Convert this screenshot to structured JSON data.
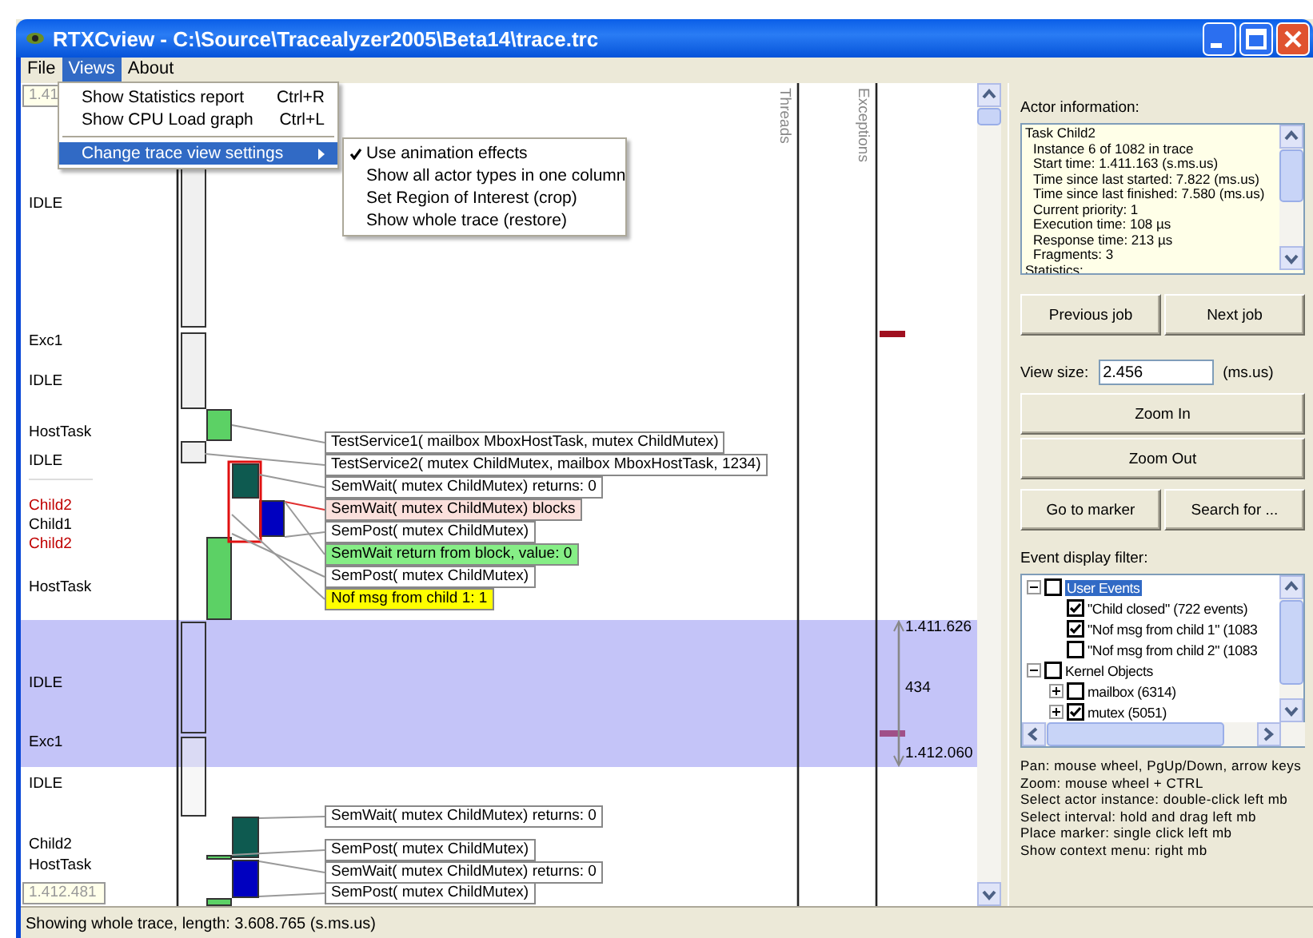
{
  "window": {
    "title": "RTXCview - C:\\Source\\Tracealyzer2005\\Beta14\\trace.trc"
  },
  "menu_bar": [
    {
      "label": "File",
      "selected": false
    },
    {
      "label": "Views",
      "selected": true
    },
    {
      "label": "About",
      "selected": false
    }
  ],
  "views_menu": {
    "items": [
      {
        "kind": "item",
        "label": "Show Statistics report",
        "shortcut": "Ctrl+R",
        "selected": false
      },
      {
        "kind": "item",
        "label": "Show CPU Load graph",
        "shortcut": "Ctrl+L",
        "selected": false
      },
      {
        "kind": "separator"
      },
      {
        "kind": "submenu",
        "label": "Change trace view settings",
        "selected": true
      }
    ],
    "submenu": [
      {
        "label": "Use animation effects",
        "checked": true
      },
      {
        "label": "Show all actor types in one column",
        "checked": false
      },
      {
        "label": "Set Region of Interest (crop)",
        "checked": false
      },
      {
        "label": "Show whole trace (restore)",
        "checked": false
      }
    ]
  },
  "trace": {
    "top_time": "1.41",
    "bottom_time": "1.412.481",
    "column_headers": [
      "Threads",
      "Exceptions"
    ],
    "actors": [
      {
        "label": "IDLE",
        "color": "#000000"
      },
      {
        "label": "Exc1",
        "color": "#000000"
      },
      {
        "label": "IDLE",
        "color": "#000000"
      },
      {
        "label": "HostTask",
        "color": "#000000"
      },
      {
        "label": "IDLE",
        "color": "#000000"
      },
      {
        "label": "Child2",
        "color": "#c00000"
      },
      {
        "label": "Child1",
        "color": "#000000"
      },
      {
        "label": "Child2",
        "color": "#c00000"
      },
      {
        "label": "HostTask",
        "color": "#000000"
      },
      {
        "label": "IDLE",
        "color": "#000000"
      },
      {
        "label": "Exc1",
        "color": "#000000"
      },
      {
        "label": "IDLE",
        "color": "#000000"
      },
      {
        "label": "Child2",
        "color": "#000000"
      },
      {
        "label": "HostTask",
        "color": "#000000"
      }
    ],
    "events": [
      {
        "text": "TestService1( mailbox MboxHostTask, mutex ChildMutex)",
        "kind": "plain"
      },
      {
        "text": "TestService2( mutex ChildMutex, mailbox MboxHostTask, 1234)",
        "kind": "plain"
      },
      {
        "text": "SemWait( mutex ChildMutex) returns: 0",
        "kind": "plain"
      },
      {
        "text": "SemWait( mutex ChildMutex) blocks",
        "kind": "blocked"
      },
      {
        "text": "SemPost( mutex ChildMutex)",
        "kind": "plain"
      },
      {
        "text": "SemWait return from block, value: 0",
        "kind": "resumed"
      },
      {
        "text": "SemPost( mutex ChildMutex)",
        "kind": "plain"
      },
      {
        "text": "Nof msg from child 1: 1",
        "kind": "user"
      },
      {
        "text": "SemWait( mutex ChildMutex) returns: 0",
        "kind": "plain"
      },
      {
        "text": "SemPost( mutex ChildMutex)",
        "kind": "plain"
      },
      {
        "text": "SemWait( mutex ChildMutex) returns: 0",
        "kind": "plain"
      },
      {
        "text": "SemPost( mutex ChildMutex)",
        "kind": "plain"
      }
    ],
    "interval": {
      "start": "1.411.626",
      "length": "434",
      "end": "1.412.060"
    }
  },
  "side_panel": {
    "actor_info": {
      "label": "Actor information:",
      "title": "Task Child2",
      "details": [
        "Instance 6 of 1082 in trace",
        "Start time: 1.411.163 (s.ms.us)",
        "Time since last started: 7.822 (ms.us)",
        "Time since last finished: 7.580 (ms.us)",
        "Current priority: 1",
        "Execution time: 108 µs",
        "Response time: 213 µs",
        "Fragments: 3"
      ],
      "footer": "Statistics:"
    },
    "job_buttons": [
      "Previous job",
      "Next job"
    ],
    "view_size": {
      "label": "View size:",
      "value": "2.456",
      "unit": "(ms.us)"
    },
    "zoom_buttons": [
      "Zoom In",
      "Zoom Out"
    ],
    "nav_buttons": [
      "Go to marker",
      "Search for ..."
    ],
    "filter": {
      "label": "Event display filter:",
      "tree": [
        {
          "label": "User Events",
          "checked": false,
          "expanded": true,
          "selected": true,
          "children": [
            {
              "label": "\"Child closed\" (722 events)",
              "checked": true,
              "selected": false
            },
            {
              "label": "\"Nof msg from child 1\" (1083",
              "checked": true,
              "selected": false
            },
            {
              "label": "\"Nof msg from child 2\" (1083",
              "checked": false,
              "selected": false
            }
          ]
        },
        {
          "label": "Kernel Objects",
          "checked": false,
          "expanded": true,
          "selected": false,
          "children": [
            {
              "label": "mailbox (6314)",
              "checked": false,
              "expanded": false,
              "selected": false
            },
            {
              "label": "mutex (5051)",
              "checked": true,
              "expanded": false,
              "selected": false
            }
          ]
        }
      ]
    },
    "help": [
      "Pan: mouse wheel, PgUp/Down, arrow keys",
      "Zoom: mouse wheel + CTRL",
      "Select actor instance: double-click left mb",
      "Select interval: hold and drag left mb",
      "Place marker: single click left mb",
      "Show context menu: right mb"
    ]
  },
  "status_bar": "Showing whole trace, length: 3.608.765 (s.ms.us)"
}
